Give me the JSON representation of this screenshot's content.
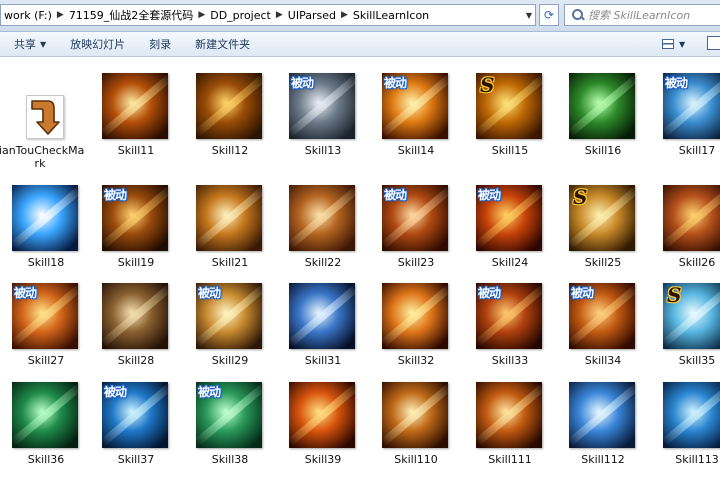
{
  "address": {
    "crumbs": [
      "work (F:)",
      "71159_仙战2全套源代码",
      "DD_project",
      "UIParsed",
      "SkillLearnIcon"
    ]
  },
  "search": {
    "placeholder": "搜索 SkillLearnIcon"
  },
  "toolbar": {
    "share": "共享",
    "slideshow": "放映幻灯片",
    "burn": "刻录",
    "new_folder": "新建文件夹"
  },
  "badge_text": "被动",
  "s_text": "S",
  "files": [
    {
      "name": "JianTouCheckMark",
      "icon": "arrow-file-icon"
    },
    {
      "name": "Skill11",
      "icon": "spear-skill-icon",
      "c1": "#ffe9a0",
      "c2": "#b5500a",
      "c3": "#2a0d00"
    },
    {
      "name": "Skill12",
      "icon": "arrows-skill-icon",
      "c1": "#ffd46a",
      "c2": "#9c4d07",
      "c3": "#2b1400"
    },
    {
      "name": "Skill13",
      "icon": "eagle-skill-icon",
      "c1": "#e8eef5",
      "c2": "#6d7b8a",
      "c3": "#1a232c",
      "badge": "passive"
    },
    {
      "name": "Skill14",
      "icon": "fire-swirl-skill-icon",
      "c1": "#fff2b0",
      "c2": "#e07b12",
      "c3": "#3a0f00",
      "badge": "passive"
    },
    {
      "name": "Skill15",
      "icon": "gold-rings-skill-icon",
      "c1": "#ffe27a",
      "c2": "#c06a05",
      "c3": "#3a1500",
      "badge": "s"
    },
    {
      "name": "Skill16",
      "icon": "green-arrow-skill-icon",
      "c1": "#b8ffb0",
      "c2": "#2d8a2a",
      "c3": "#051a05"
    },
    {
      "name": "Skill17",
      "icon": "blue-ice-skill-icon",
      "c1": "#d8f4ff",
      "c2": "#3a8ed0",
      "c3": "#0a1e3a",
      "badge": "passive"
    },
    {
      "name": "Skill18",
      "icon": "blue-burst-skill-icon",
      "c1": "#ffffff",
      "c2": "#3aa6ff",
      "c3": "#061a40"
    },
    {
      "name": "Skill19",
      "icon": "silhouette-skill-icon",
      "c1": "#ffd070",
      "c2": "#9a4b0c",
      "c3": "#1f0b00",
      "badge": "passive"
    },
    {
      "name": "Skill21",
      "icon": "wind-slash-skill-icon",
      "c1": "#fff0c0",
      "c2": "#c5781d",
      "c3": "#3a1a05"
    },
    {
      "name": "Skill22",
      "icon": "blade-skill-icon",
      "c1": "#fbe0a8",
      "c2": "#b46420",
      "c3": "#3b1605"
    },
    {
      "name": "Skill23",
      "icon": "holy-cross-skill-icon",
      "c1": "#ffd7a0",
      "c2": "#b04a12",
      "c3": "#2e0a00",
      "badge": "passive"
    },
    {
      "name": "Skill24",
      "icon": "flame-skill-icon",
      "c1": "#ffd060",
      "c2": "#c8440a",
      "c3": "#2c0500",
      "badge": "passive"
    },
    {
      "name": "Skill25",
      "icon": "sword-skill-icon",
      "c1": "#fff0b0",
      "c2": "#c88a2a",
      "c3": "#2f1800",
      "badge": "s"
    },
    {
      "name": "Skill26",
      "icon": "shield-skill-icon",
      "c1": "#ffd070",
      "c2": "#b3501a",
      "c3": "#2d0a00"
    },
    {
      "name": "Skill27",
      "icon": "power-fist-skill-icon",
      "c1": "#ffe38a",
      "c2": "#d4661a",
      "c3": "#3a0e00",
      "badge": "passive"
    },
    {
      "name": "Skill28",
      "icon": "multi-blade-skill-icon",
      "c1": "#f5e0b0",
      "c2": "#8a6030",
      "c3": "#231005"
    },
    {
      "name": "Skill29",
      "icon": "radiant-wheel-skill-icon",
      "c1": "#fff4c0",
      "c2": "#c88a30",
      "c3": "#2d1605",
      "badge": "passive"
    },
    {
      "name": "Skill31",
      "icon": "lightning-skill-icon",
      "c1": "#e6f5ff",
      "c2": "#3a76c8",
      "c3": "#050f26"
    },
    {
      "name": "Skill32",
      "icon": "fire-pillar-skill-icon",
      "c1": "#fff0a0",
      "c2": "#e0761a",
      "c3": "#2c0700"
    },
    {
      "name": "Skill33",
      "icon": "fire-hand-skill-icon",
      "c1": "#ffc870",
      "c2": "#b2420e",
      "c3": "#240500",
      "badge": "passive"
    },
    {
      "name": "Skill34",
      "icon": "glowing-figure-skill-icon",
      "c1": "#ffd080",
      "c2": "#c25a12",
      "c3": "#300a00",
      "badge": "passive"
    },
    {
      "name": "Skill35",
      "icon": "ice-shards-skill-icon",
      "c1": "#e8fbff",
      "c2": "#58b6e0",
      "c3": "#0b2a45",
      "badge": "s"
    },
    {
      "name": "Skill36",
      "icon": "green-aura-skill-icon",
      "c1": "#b8ffc8",
      "c2": "#1f8a4a",
      "c3": "#032010"
    },
    {
      "name": "Skill37",
      "icon": "blue-orb-skill-icon",
      "c1": "#d0f4ff",
      "c2": "#1e78c8",
      "c3": "#031630",
      "badge": "passive"
    },
    {
      "name": "Skill38",
      "icon": "green-cross-skill-icon",
      "c1": "#c0ffd0",
      "c2": "#2a9a5a",
      "c3": "#032a18",
      "badge": "passive"
    },
    {
      "name": "Skill39",
      "icon": "fireball-skill-icon",
      "c1": "#ffe080",
      "c2": "#d8540c",
      "c3": "#2c0700"
    },
    {
      "name": "Skill110",
      "icon": "golden-spear-skill-icon",
      "c1": "#fff0b8",
      "c2": "#c06a18",
      "c3": "#2a0c00"
    },
    {
      "name": "Skill111",
      "icon": "arrow-rain-skill-icon",
      "c1": "#ffe6a0",
      "c2": "#c25a10",
      "c3": "#250800"
    },
    {
      "name": "Skill112",
      "icon": "ice-arrows-skill-icon",
      "c1": "#e8f8ff",
      "c2": "#3a86d8",
      "c3": "#081a3a"
    },
    {
      "name": "Skill113",
      "icon": "water-wave-skill-icon",
      "c1": "#d0f2ff",
      "c2": "#2a86d0",
      "c3": "#04183a"
    }
  ]
}
